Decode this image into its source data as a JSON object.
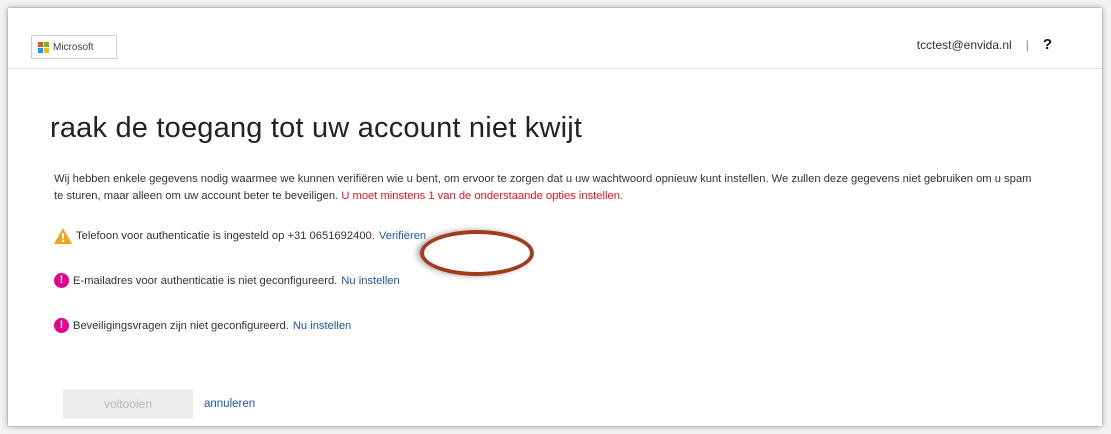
{
  "header": {
    "logo_text": "Microsoft",
    "user_email": "tcctest@envida.nl",
    "separator": "|",
    "help_label": "?"
  },
  "page": {
    "title": "raak de toegang tot uw account niet kwijt",
    "intro_text": "Wij hebben enkele gegevens nodig waarmee we kunnen verifiëren wie u bent, om ervoor te zorgen dat u uw wachtwoord opnieuw kunt instellen. We zullen deze gegevens niet gebruiken om u spam te sturen, maar alleen om uw account beter te beveiligen.",
    "intro_required": "U moet minstens 1 van de onderstaande opties instellen."
  },
  "options": [
    {
      "status": "warning",
      "text": "Telefoon voor authenticatie is ingesteld op +31 0651692400.",
      "action": "Verifiëren"
    },
    {
      "status": "error",
      "text": "E-mailadres voor authenticatie is niet geconfigureerd.",
      "action": "Nu instellen"
    },
    {
      "status": "error",
      "text": "Beveiligingsvragen zijn niet geconfigureerd.",
      "action": "Nu instellen"
    }
  ],
  "footer": {
    "finish_label": "voltooien",
    "cancel_label": "annuleren"
  },
  "colors": {
    "link": "#2255aa",
    "required": "#e81123",
    "warning": "#f7a21b",
    "error": "#e3008c",
    "highlight": "#a03c1e"
  }
}
